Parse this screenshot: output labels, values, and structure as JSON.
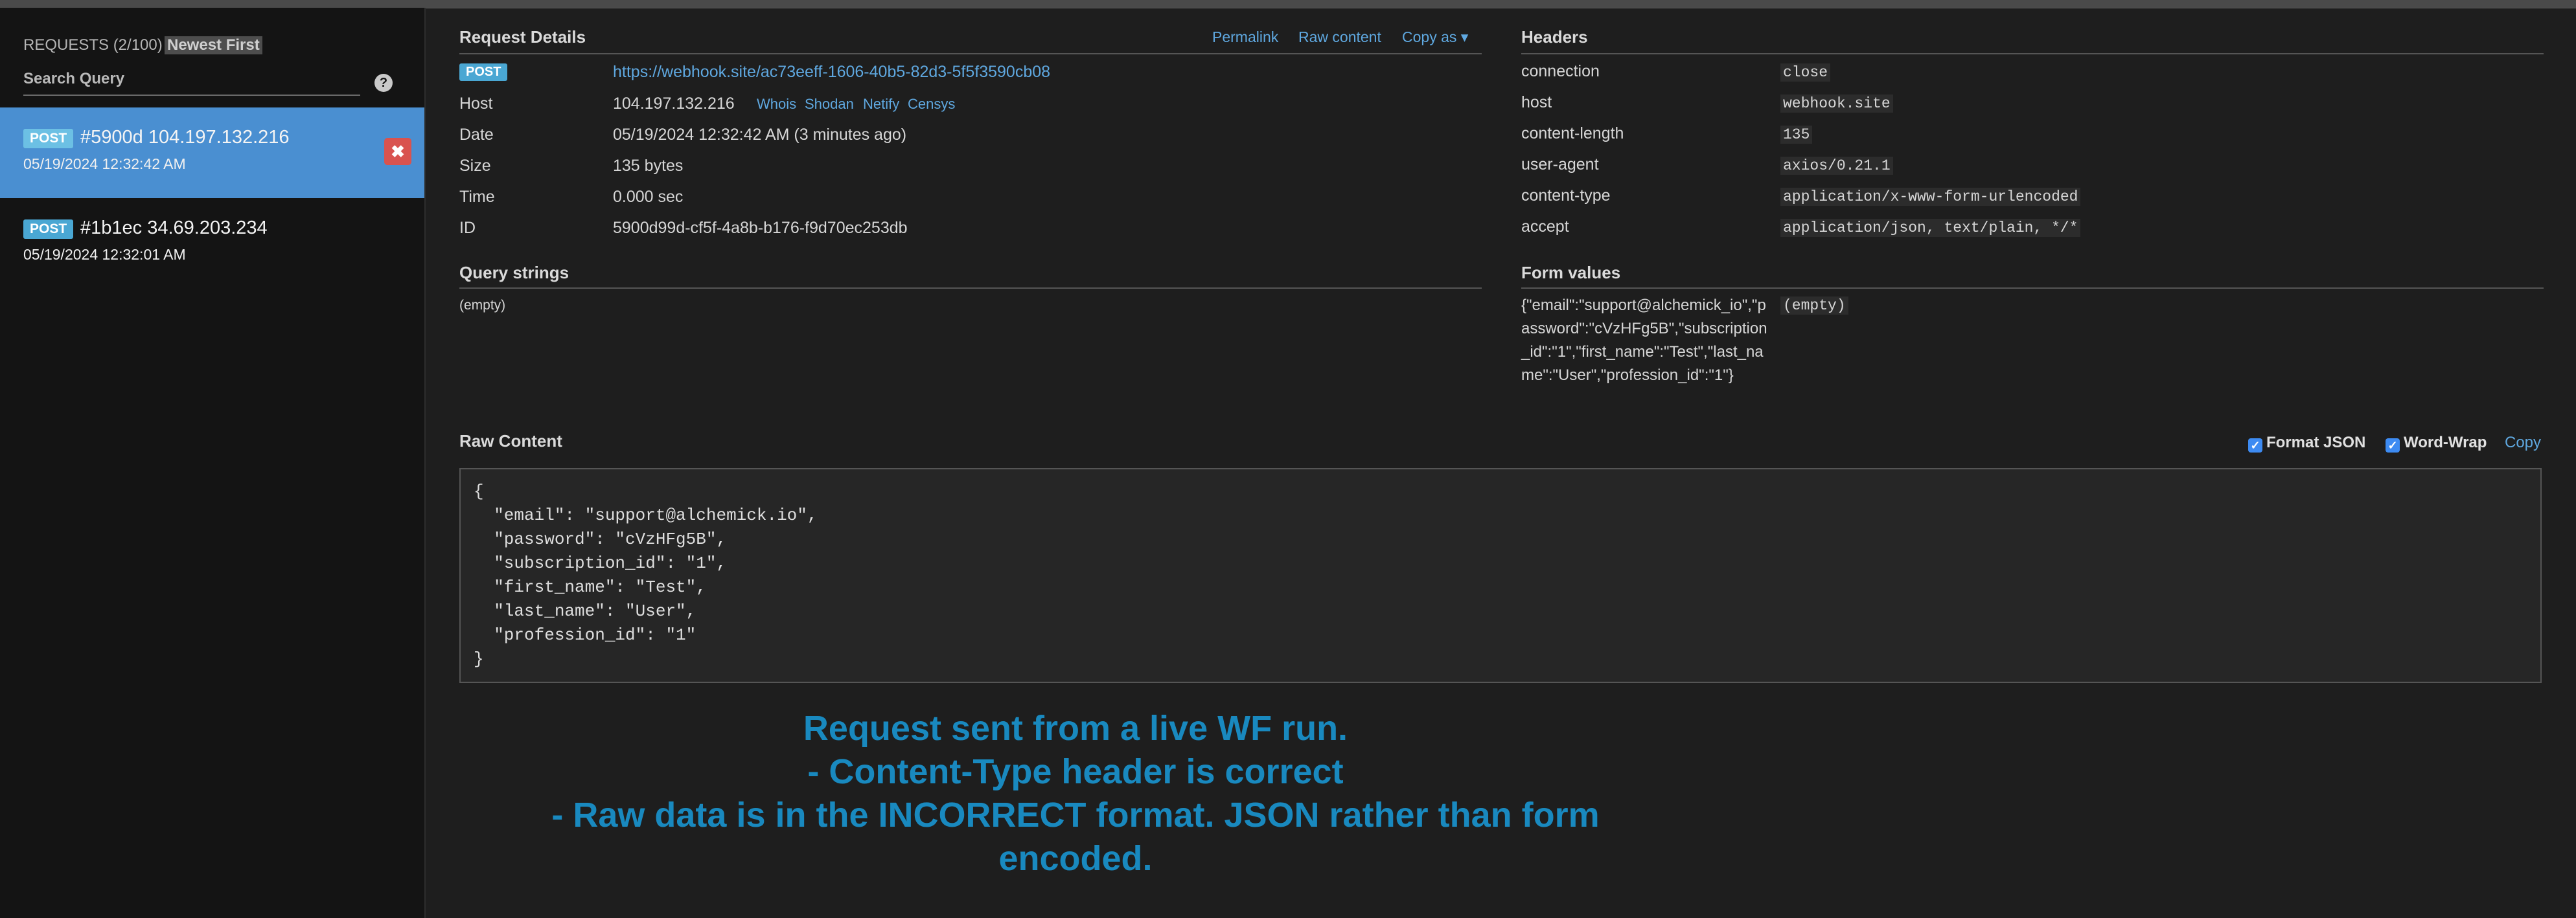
{
  "sidebar": {
    "header": "REQUESTS (2/100)",
    "sort_label": "Newest First",
    "search_placeholder": "Search Query",
    "help": "?",
    "requests": [
      {
        "method": "POST",
        "title": "#5900d 104.197.132.216",
        "time": "05/19/2024 12:32:42 AM",
        "delete": "✖"
      },
      {
        "method": "POST",
        "title": "#1b1ec 34.69.203.234",
        "time": "05/19/2024 12:32:01 AM"
      }
    ]
  },
  "details": {
    "title": "Request Details",
    "links": [
      "Permalink",
      "Raw content",
      "Copy as ▾"
    ],
    "method": "POST",
    "url": "https://webhook.site/ac73eeff-1606-40b5-82d3-5f5f3590cb08",
    "rows": [
      {
        "label": "Host",
        "value": "104.197.132.216"
      },
      {
        "label": "Date",
        "value": "05/19/2024 12:32:42 AM (3 minutes ago)"
      },
      {
        "label": "Size",
        "value": "135 bytes"
      },
      {
        "label": "Time",
        "value": "0.000 sec"
      },
      {
        "label": "ID",
        "value": "5900d99d-cf5f-4a8b-b176-f9d70ec253db"
      }
    ],
    "host_links": [
      "Whois",
      "Shodan",
      "Netify",
      "Censys"
    ]
  },
  "headers": {
    "title": "Headers",
    "rows": [
      {
        "label": "connection",
        "value": "close"
      },
      {
        "label": "host",
        "value": "webhook.site"
      },
      {
        "label": "content-length",
        "value": "135"
      },
      {
        "label": "user-agent",
        "value": "axios/0.21.1"
      },
      {
        "label": "content-type",
        "value": "application/x-www-form-urlencoded"
      },
      {
        "label": "accept",
        "value": "application/json, text/plain, */*"
      }
    ]
  },
  "query": {
    "title": "Query strings",
    "value": "(empty)"
  },
  "form": {
    "title": "Form values",
    "key": "{\"email\":\"support@alchemick_io\",\"password\":\"cVzHFg5B\",\"subscription_id\":\"1\",\"first_name\":\"Test\",\"last_name\":\"User\",\"profession_id\":\"1\"}",
    "value": "(empty)"
  },
  "raw": {
    "title": "Raw Content",
    "format_json": "Format JSON",
    "word_wrap": "Word-Wrap",
    "copy": "Copy",
    "content": "{\n  \"email\": \"support@alchemick.io\",\n  \"password\": \"cVzHFg5B\",\n  \"subscription_id\": \"1\",\n  \"first_name\": \"Test\",\n  \"last_name\": \"User\",\n  \"profession_id\": \"1\"\n}"
  },
  "annotation": {
    "line1": "Request sent from a live WF run.",
    "line2": "- Content-Type header is correct",
    "line3": "- Raw data is in the INCORRECT format. JSON rather than form",
    "line4": "encoded."
  },
  "colors": {
    "accent": "#4a8fd1",
    "link": "#5fa8e0",
    "annotation": "#1989bf",
    "delete": "#d9534f"
  }
}
